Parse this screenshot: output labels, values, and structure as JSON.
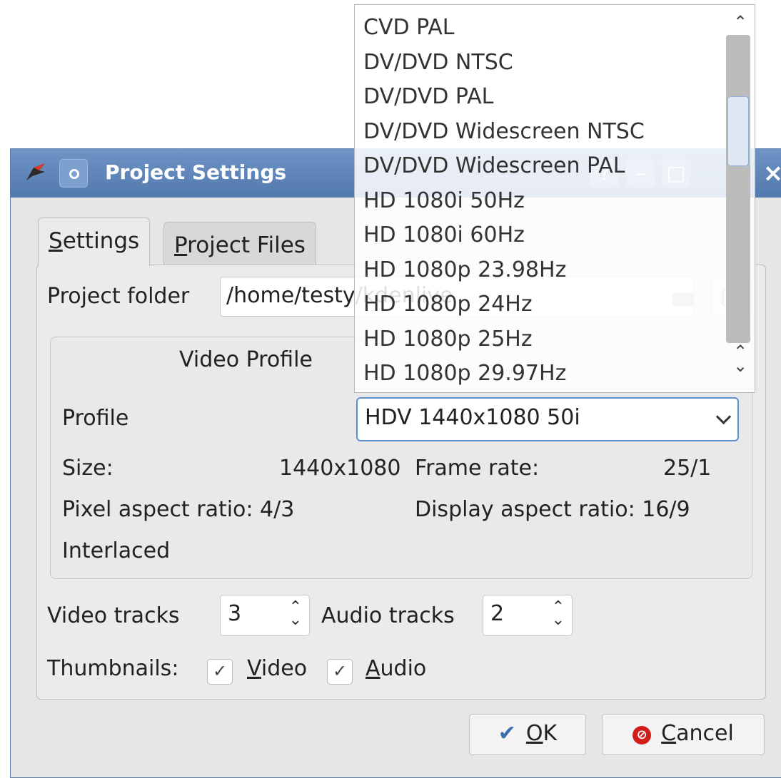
{
  "window": {
    "title": "Project Settings",
    "help_label": "?",
    "close_label": "×"
  },
  "tabs": [
    {
      "label": "Settings",
      "mnemonic": "S",
      "rest": "ettings"
    },
    {
      "label": "Project Files",
      "mnemonic": "P",
      "rest": "roject Files"
    }
  ],
  "project_folder": {
    "label": "Project folder",
    "value": "/home/testy/kdenlive"
  },
  "video_profile": {
    "group_title": "Video Profile",
    "profile_label": "Profile",
    "selected_profile": "HDV 1440x1080 50i",
    "size_label": "Size:",
    "size_value": "1440x1080",
    "frame_rate_label": "Frame rate:",
    "frame_rate_value": "25/1",
    "pixel_aspect_label": "Pixel aspect ratio: 4/3",
    "display_aspect_label": "Display aspect ratio: 16/9",
    "scan": "Interlaced"
  },
  "tracks": {
    "video_label": "Video tracks",
    "video_value": "3",
    "audio_label": "Audio tracks",
    "audio_value": "2"
  },
  "thumbnails": {
    "label": "Thumbnails:",
    "video": {
      "mnemonic": "V",
      "rest": "ideo",
      "checked": true
    },
    "audio": {
      "mnemonic": "A",
      "rest": "udio",
      "checked": true
    }
  },
  "buttons": {
    "ok_mnemonic": "O",
    "ok_rest": "K",
    "cancel_mnemonic": "C",
    "cancel_rest": "ancel"
  },
  "dropdown_options": [
    "CVD PAL",
    "DV/DVD NTSC",
    "DV/DVD PAL",
    "DV/DVD Widescreen NTSC",
    "DV/DVD Widescreen PAL",
    "HD 1080i 50Hz",
    "HD 1080i 60Hz",
    "HD 1080p 23.98Hz",
    "HD 1080p 24Hz",
    "HD 1080p 25Hz",
    "HD 1080p 29.97Hz"
  ],
  "icons": {
    "check": "✓",
    "ok": "✔",
    "cancel": "⊘",
    "scroll_up": "⌃",
    "spin_arrows": "⇕"
  },
  "colors": {
    "titlebar": "#5f86b9",
    "focus": "#5b8fd0",
    "cancel_red": "#d11d1d"
  }
}
